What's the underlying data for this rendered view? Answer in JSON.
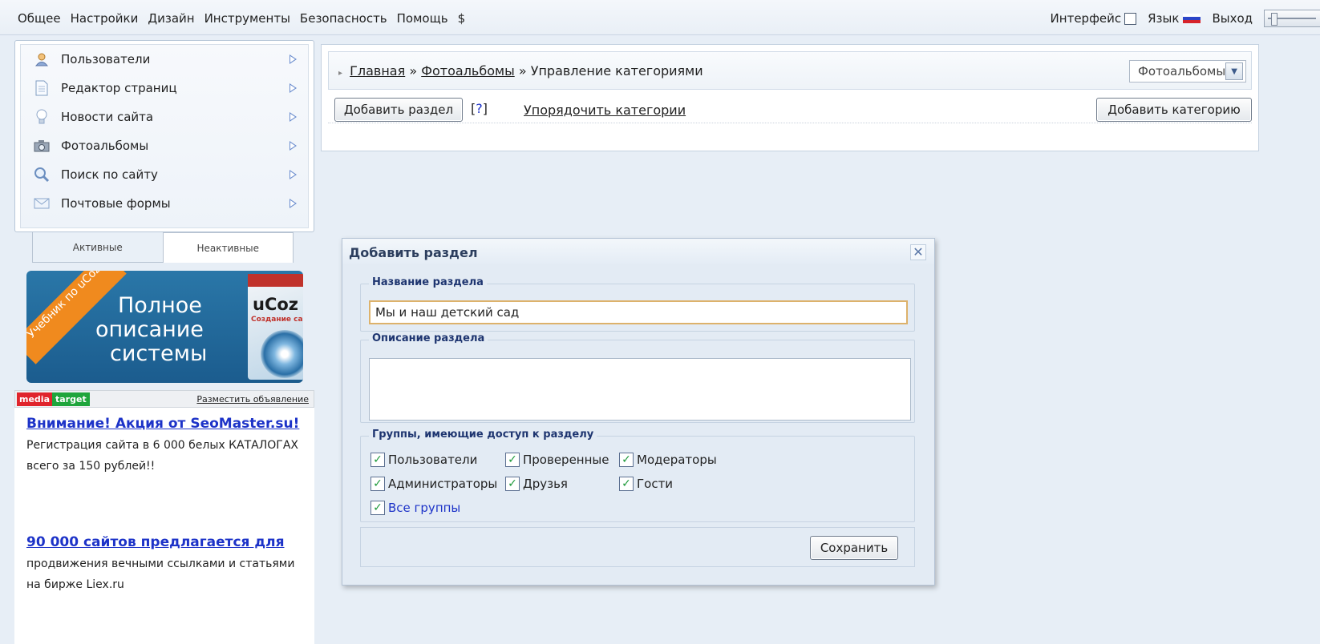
{
  "topmenu": [
    "Общее",
    "Настройки",
    "Дизайн",
    "Инструменты",
    "Безопасность",
    "Помощь",
    "$"
  ],
  "topright": {
    "interface": "Интерфейс",
    "language": "Язык",
    "logout": "Выход"
  },
  "leftnav": [
    {
      "label": "Пользователи",
      "icon": "user-icon"
    },
    {
      "label": "Редактор страниц",
      "icon": "page-icon"
    },
    {
      "label": "Новости сайта",
      "icon": "bulb-icon"
    },
    {
      "label": "Фотоальбомы",
      "icon": "camera-icon"
    },
    {
      "label": "Поиск по сайту",
      "icon": "search-icon"
    },
    {
      "label": "Почтовые формы",
      "icon": "mail-icon"
    }
  ],
  "tabs": {
    "active": "Активные",
    "inactive": "Неактивные"
  },
  "banner": {
    "ribbon": "Учебник по uCoz",
    "line1": "Полное",
    "line2": "описание",
    "line3": "системы",
    "brand": "uCoz",
    "sub": "Создание сайтов"
  },
  "adbar": {
    "media": "media",
    "target": "target",
    "place": "Разместить объявление"
  },
  "ads": [
    {
      "title": "Внимание! Акция от SeoMaster.su!",
      "desc": "Регистрация сайта в 6 000 белых КАТАЛОГАХ всего за 150 рублей!!"
    },
    {
      "title": "90 000 сайтов предлагается для",
      "desc": "продвижения вечными ссылками и статьями на бирже Liex.ru"
    }
  ],
  "breadcrumb": {
    "home": "Главная",
    "sep": "»",
    "albums": "Фотоальбомы",
    "current": "Управление категориями"
  },
  "module_select": "Фотоальбомы",
  "actions": {
    "add_section": "Добавить раздел",
    "help": "[?]",
    "sort": "Упорядочить категории",
    "add_category": "Добавить категорию"
  },
  "dialog": {
    "title": "Добавить раздел",
    "name_legend": "Название раздела",
    "name_value": "Мы и наш детский сад",
    "desc_legend": "Описание раздела",
    "groups_legend": "Группы, имеющие доступ к разделу",
    "groups": [
      "Пользователи",
      "Проверенные",
      "Модераторы",
      "Администраторы",
      "Друзья",
      "Гости"
    ],
    "all_groups": "Все группы",
    "save": "Сохранить"
  }
}
